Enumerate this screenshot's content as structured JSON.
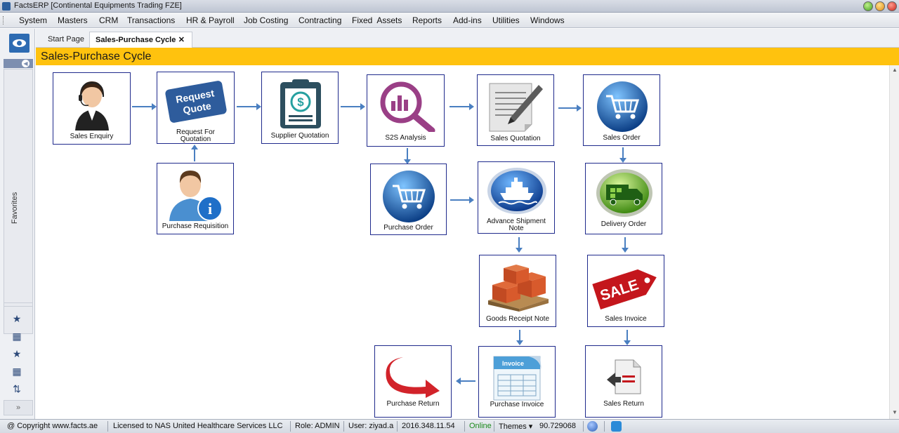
{
  "window": {
    "title": "FactsERP [Continental Equipments Trading FZE]"
  },
  "menu": [
    "System",
    "Masters",
    "CRM",
    "Transactions",
    "HR & Payroll",
    "Job Costing",
    "Contracting",
    "Fixed  Assets",
    "Reports",
    "Add-ins",
    "Utilities",
    "Windows"
  ],
  "sidebar": {
    "favorites_label": "Favorites",
    "more_label": "»"
  },
  "tabs": {
    "start": "Start Page",
    "active": "Sales-Purchase Cycle",
    "close": "✕"
  },
  "page": {
    "title": "Sales-Purchase Cycle"
  },
  "nodes": {
    "sales_enquiry": "Sales Enquiry",
    "rfq_line1": "Request For",
    "rfq_line2": "Quotation",
    "rfq_badge_line1": "Request",
    "rfq_badge_line2": "Quote",
    "supplier_quotation": "Supplier Quotation",
    "s2s_analysis": "S2S Analysis",
    "sales_quotation": "Sales Quotation",
    "sales_order": "Sales Order",
    "purchase_requisition": "Purchase Requisition",
    "purchase_order": "Purchase Order",
    "asn_line1": "Advance Shipment",
    "asn_line2": "Note",
    "delivery_order": "Delivery Order",
    "goods_receipt_note": "Goods Receipt Note",
    "sales_invoice": "Sales Invoice",
    "sale_tag": "SALE",
    "purchase_return": "Purchase Return",
    "purchase_invoice": "Purchase Invoice",
    "invoice_tag": "Invoice",
    "sales_return": "Sales Return"
  },
  "status": {
    "copyright": "@ Copyright www.facts.ae",
    "license": "Licensed to NAS United Healthcare Services LLC",
    "role": "Role: ADMIN",
    "user": "User: ziyad.a",
    "version": "2016.348.11.54",
    "online": "Online",
    "themes": "Themes ▾",
    "value": "90.729068"
  },
  "colors": {
    "accent": "#ffc20e",
    "node_border": "#1f2a8c",
    "arrow": "#4a7fc1",
    "online": "#1b8a1b"
  }
}
